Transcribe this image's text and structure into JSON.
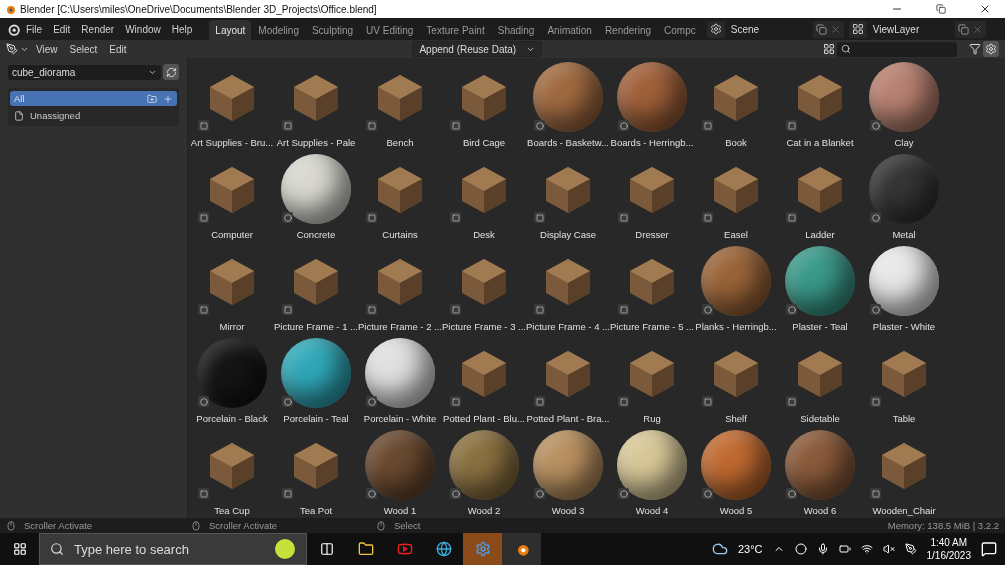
{
  "window": {
    "title": "Blender [C:\\Users\\miles\\OneDrive\\Documents\\Blender 3D_Projects\\Office.blend]"
  },
  "menu": [
    "File",
    "Edit",
    "Render",
    "Window",
    "Help"
  ],
  "workspace_tabs": [
    {
      "label": "Layout",
      "selected": true
    },
    {
      "label": "Modeling",
      "selected": false
    },
    {
      "label": "Sculpting",
      "selected": false
    },
    {
      "label": "UV Editing",
      "selected": false
    },
    {
      "label": "Texture Paint",
      "selected": false
    },
    {
      "label": "Shading",
      "selected": false
    },
    {
      "label": "Animation",
      "selected": false
    },
    {
      "label": "Rendering",
      "selected": false
    },
    {
      "label": "Compc",
      "selected": false
    }
  ],
  "scene": "Scene",
  "view_layer": "ViewLayer",
  "header": {
    "menu": [
      "View",
      "Select",
      "Edit"
    ],
    "import_mode": "Append (Reuse Data)"
  },
  "sidebar": {
    "library": "cube_diorama",
    "catalogs": [
      {
        "label": "All",
        "selected": true
      },
      {
        "label": "Unassigned",
        "selected": false
      }
    ]
  },
  "assets": [
    {
      "name": "Art Supplies - Bru...",
      "kind": "object"
    },
    {
      "name": "Art Supplies - Pale",
      "kind": "object"
    },
    {
      "name": "Bench",
      "kind": "object"
    },
    {
      "name": "Bird Cage",
      "kind": "object"
    },
    {
      "name": "Boards - Basketw...",
      "kind": "material",
      "color": "#a06a40"
    },
    {
      "name": "Boards - Herringb...",
      "kind": "material",
      "color": "#a0603a"
    },
    {
      "name": "Book",
      "kind": "object"
    },
    {
      "name": "Cat in a Blanket",
      "kind": "object"
    },
    {
      "name": "Clay",
      "kind": "material",
      "color": "#b88070"
    },
    {
      "name": "Computer",
      "kind": "object"
    },
    {
      "name": "Concrete",
      "kind": "material",
      "color": "#d8d8d0"
    },
    {
      "name": "Curtains",
      "kind": "object"
    },
    {
      "name": "Desk",
      "kind": "object"
    },
    {
      "name": "Display Case",
      "kind": "object"
    },
    {
      "name": "Dresser",
      "kind": "object"
    },
    {
      "name": "Easel",
      "kind": "object"
    },
    {
      "name": "Ladder",
      "kind": "object"
    },
    {
      "name": "Metal",
      "kind": "material",
      "color": "#353535"
    },
    {
      "name": "Mirror",
      "kind": "object"
    },
    {
      "name": "Picture Frame - 1 ...",
      "kind": "object"
    },
    {
      "name": "Picture Frame - 2 ...",
      "kind": "object"
    },
    {
      "name": "Picture Frame - 3 ...",
      "kind": "object"
    },
    {
      "name": "Picture Frame - 4 ...",
      "kind": "object"
    },
    {
      "name": "Picture Frame - 5 ...",
      "kind": "object"
    },
    {
      "name": "Planks - Herringb...",
      "kind": "material",
      "color": "#9a6438"
    },
    {
      "name": "Plaster - Teal",
      "kind": "material",
      "color": "#3a9a8a"
    },
    {
      "name": "Plaster - White",
      "kind": "material",
      "color": "#e8e8e8"
    },
    {
      "name": "Porcelain - Black",
      "kind": "material",
      "color": "#151515"
    },
    {
      "name": "Porcelain - Teal",
      "kind": "material",
      "color": "#30a8b8"
    },
    {
      "name": "Porcelain - White",
      "kind": "material",
      "color": "#e0e0e0"
    },
    {
      "name": "Potted Plant - Blu...",
      "kind": "object"
    },
    {
      "name": "Potted Plant - Bra...",
      "kind": "object"
    },
    {
      "name": "Rug",
      "kind": "object"
    },
    {
      "name": "Shelf",
      "kind": "object"
    },
    {
      "name": "Sidetable",
      "kind": "object"
    },
    {
      "name": "Table",
      "kind": "object"
    },
    {
      "name": "Tea Cup",
      "kind": "object"
    },
    {
      "name": "Tea Pot",
      "kind": "object"
    },
    {
      "name": "Wood 1",
      "kind": "material",
      "color": "#6a4a30"
    },
    {
      "name": "Wood 2",
      "kind": "material",
      "color": "#8a7040"
    },
    {
      "name": "Wood 3",
      "kind": "material",
      "color": "#b89060"
    },
    {
      "name": "Wood 4",
      "kind": "material",
      "color": "#d8c898"
    },
    {
      "name": "Wood 5",
      "kind": "material",
      "color": "#c06a30"
    },
    {
      "name": "Wood 6",
      "kind": "material",
      "color": "#8a5a3a"
    },
    {
      "name": "Wooden_Chair",
      "kind": "object"
    }
  ],
  "status_bar": {
    "hints": [
      "Scroller Activate",
      "Scroller Activate",
      "Select"
    ],
    "memory": "Memory: 138.5 MiB | 3.2.2"
  },
  "taskbar": {
    "search_placeholder": "Type here to search",
    "temperature": "23°C",
    "time": "1:40 AM",
    "date": "1/16/2023"
  }
}
